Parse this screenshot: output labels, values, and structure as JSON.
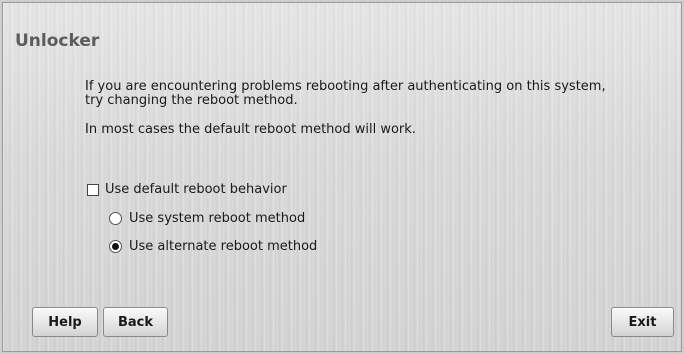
{
  "window": {
    "title": "Unlocker"
  },
  "content": {
    "paragraph1": "If you are encountering problems rebooting after authenticating on this system, try changing the reboot method.",
    "paragraph2": "In most cases the default reboot method will work."
  },
  "options": {
    "default_checkbox": {
      "label": "Use default reboot behavior",
      "checked": false
    },
    "radios": [
      {
        "label": "Use system reboot method",
        "selected": false
      },
      {
        "label": "Use alternate reboot method",
        "selected": true
      }
    ]
  },
  "buttons": {
    "help": "Help",
    "back": "Back",
    "exit": "Exit"
  }
}
